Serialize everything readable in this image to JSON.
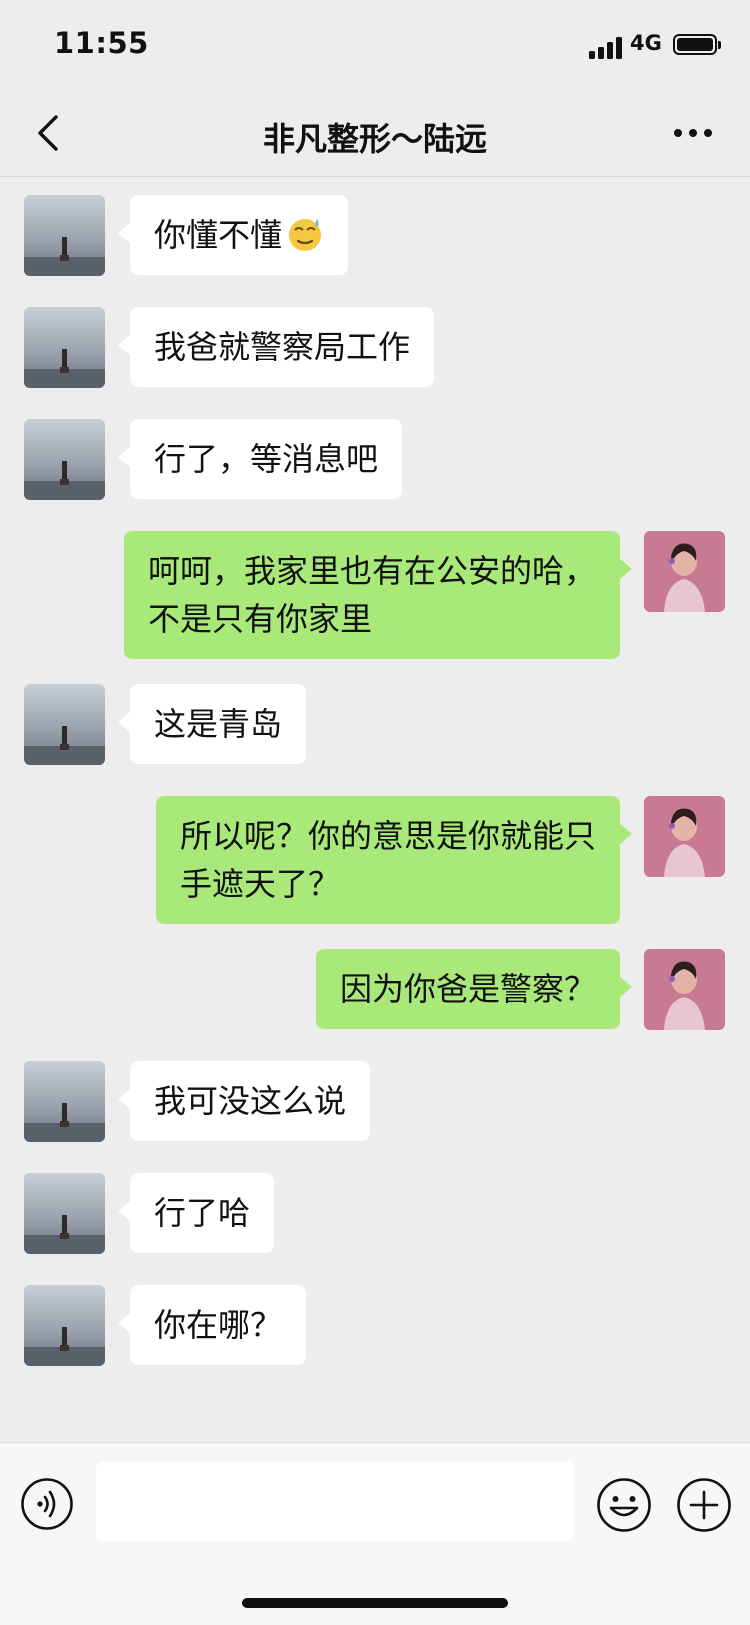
{
  "status_bar": {
    "time": "11:55",
    "network": "4G"
  },
  "header": {
    "title": "非凡整形～陆远"
  },
  "messages": [
    {
      "side": "left",
      "lines": [
        "你懂不懂"
      ],
      "emoji": "sweat-smile-emoji"
    },
    {
      "side": "left",
      "lines": [
        "我爸就警察局工作"
      ]
    },
    {
      "side": "left",
      "lines": [
        "行了，等消息吧"
      ]
    },
    {
      "side": "right",
      "lines": [
        "呵呵，我家里也有在公安的哈，",
        "不是只有你家里"
      ]
    },
    {
      "side": "left",
      "lines": [
        "这是青岛"
      ]
    },
    {
      "side": "right",
      "lines": [
        "所以呢？你的意思是你就能只",
        "手遮天了？"
      ]
    },
    {
      "side": "right",
      "lines": [
        "因为你爸是警察？"
      ]
    },
    {
      "side": "left",
      "lines": [
        "我可没这么说"
      ]
    },
    {
      "side": "left",
      "lines": [
        "行了哈"
      ]
    },
    {
      "side": "left",
      "lines": [
        "你在哪？"
      ]
    }
  ],
  "input_bar": {
    "text_value": ""
  },
  "colors": {
    "background": "#ededed",
    "bubble_self": "#a9e97a",
    "bubble_other": "#ffffff"
  }
}
